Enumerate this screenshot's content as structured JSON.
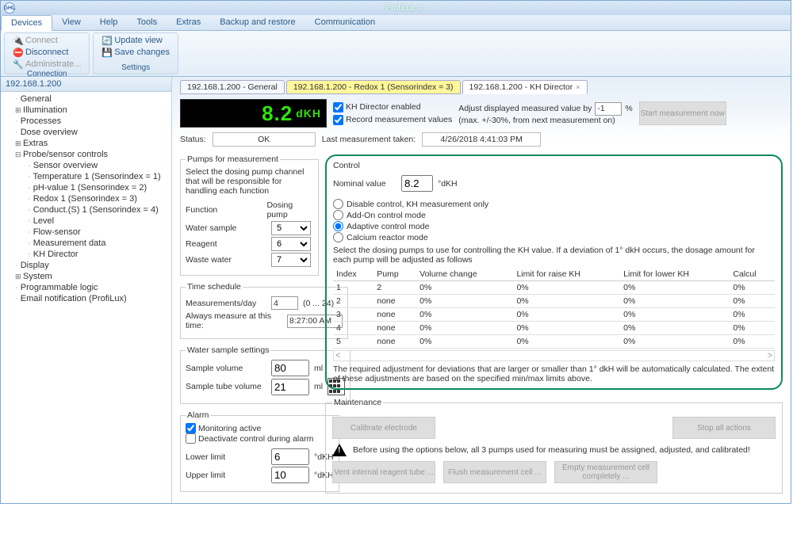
{
  "title": "ProfiLux 4",
  "menu": [
    "Devices",
    "View",
    "Help",
    "Tools",
    "Extras",
    "Backup and restore",
    "Communication"
  ],
  "ribbon": {
    "connection": {
      "title": "Connection",
      "connect": "Connect",
      "disconnect": "Disconnect",
      "administrate": "Administrate..."
    },
    "settings": {
      "title": "Settings",
      "update": "Update view",
      "save": "Save changes"
    }
  },
  "tree": {
    "header": "192.168.1.200",
    "items": [
      {
        "label": "General",
        "t": "leaf",
        "lvl": 1
      },
      {
        "label": "Illumination",
        "t": "expandable",
        "lvl": 1
      },
      {
        "label": "Processes",
        "t": "leaf",
        "lvl": 1
      },
      {
        "label": "Dose overview",
        "t": "leaf",
        "lvl": 1
      },
      {
        "label": "Extras",
        "t": "expandable",
        "lvl": 1
      },
      {
        "label": "Probe/sensor controls",
        "t": "expanded",
        "lvl": 1
      },
      {
        "label": "Sensor overview",
        "t": "leaf",
        "lvl": 2
      },
      {
        "label": "Temperature 1 (Sensorindex = 1)",
        "t": "leaf",
        "lvl": 2
      },
      {
        "label": "pH-value 1 (Sensorindex = 2)",
        "t": "leaf",
        "lvl": 2
      },
      {
        "label": "Redox 1 (Sensorindex = 3)",
        "t": "leaf",
        "lvl": 2
      },
      {
        "label": "Conduct.(S) 1 (Sensorindex = 4)",
        "t": "leaf",
        "lvl": 2
      },
      {
        "label": "Level",
        "t": "leaf",
        "lvl": 2
      },
      {
        "label": "Flow-sensor",
        "t": "leaf",
        "lvl": 2
      },
      {
        "label": "Measurement data",
        "t": "leaf",
        "lvl": 2
      },
      {
        "label": "KH Director",
        "t": "leaf",
        "lvl": 2
      },
      {
        "label": "Display",
        "t": "leaf",
        "lvl": 1
      },
      {
        "label": "System",
        "t": "expandable",
        "lvl": 1
      },
      {
        "label": "Programmable logic",
        "t": "leaf",
        "lvl": 1
      },
      {
        "label": "Email notification (ProfiLux)",
        "t": "leaf",
        "lvl": 1
      }
    ]
  },
  "tabs": [
    {
      "label": "192.168.1.200 - General",
      "style": "",
      "close": false
    },
    {
      "label": "192.168.1.200 - Redox 1 (Sensorindex = 3)",
      "style": "yellow",
      "close": false
    },
    {
      "label": "192.168.1.200 - KH Director",
      "style": "active",
      "close": true
    }
  ],
  "lcd": {
    "value": "8.2",
    "unit": "dKH"
  },
  "checks": {
    "enabled": "KH Director enabled",
    "record": "Record measurement values"
  },
  "adjust": {
    "label": "Adjust displayed measured value by",
    "value": "-1",
    "unit": "%",
    "hint": "(max. +/-30%, from next measurement on)"
  },
  "start_btn": "Start measurement now",
  "status": {
    "label": "Status:",
    "value": "OK",
    "last_lbl": "Last measurement taken:",
    "last_val": "4/26/2018 4:41:03 PM"
  },
  "pumps": {
    "title": "Pumps for measurement",
    "desc": "Select the dosing pump channel that will be responsible for handling each function",
    "h1": "Function",
    "h2": "Dosing pump",
    "rows": [
      {
        "f": "Water sample",
        "p": "5"
      },
      {
        "f": "Reagent",
        "p": "6"
      },
      {
        "f": "Waste water",
        "p": "7"
      }
    ]
  },
  "schedule": {
    "title": "Time schedule",
    "meas_lbl": "Measurements/day",
    "meas_val": "4",
    "range": "(0 ... 24)",
    "always_lbl": "Always measure at this time:",
    "always_val": "8:27:00 AM"
  },
  "sample": {
    "title": "Water sample settings",
    "vol_lbl": "Sample volume",
    "vol_val": "80",
    "tube_lbl": "Sample tube volume",
    "tube_val": "21",
    "unit": "ml"
  },
  "alarm": {
    "title": "Alarm",
    "mon": "Monitoring active",
    "deact": "Deactivate control during alarm",
    "lower_lbl": "Lower limit",
    "lower_val": "6",
    "upper_lbl": "Upper limit",
    "upper_val": "10",
    "unit": "°dKH"
  },
  "control": {
    "title": "Control",
    "nominal_lbl": "Nominal value",
    "nominal_val": "8.2",
    "nominal_unit": "°dKH",
    "r1": "Disable control, KH measurement only",
    "r2": "Add-On control mode",
    "r3": "Adaptive control mode",
    "r4": "Calcium reactor mode",
    "desc": "Select the dosing pumps to use for controlling the KH value. If a deviation of 1° dkH occurs, the dosage amount for each pump will be adjusted as follows",
    "cols": [
      "Index",
      "Pump",
      "Volume change",
      "Limit for raise KH",
      "Limit for lower KH",
      "Calcul"
    ],
    "rows": [
      {
        "i": "1",
        "p": "2",
        "v": "0%",
        "r": "0%",
        "l": "0%",
        "c": "0%"
      },
      {
        "i": "2",
        "p": "none",
        "v": "0%",
        "r": "0%",
        "l": "0%",
        "c": "0%"
      },
      {
        "i": "3",
        "p": "none",
        "v": "0%",
        "r": "0%",
        "l": "0%",
        "c": "0%"
      },
      {
        "i": "4",
        "p": "none",
        "v": "0%",
        "r": "0%",
        "l": "0%",
        "c": "0%"
      },
      {
        "i": "5",
        "p": "none",
        "v": "0%",
        "r": "0%",
        "l": "0%",
        "c": "0%"
      }
    ],
    "foot": "The required adjustment for deviations that are larger or smaller than 1° dkH will be automatically calculated. The extent of these adjustments are based on the specified min/max limits above."
  },
  "maint": {
    "title": "Maintenance",
    "b1": "Calibrate electrode",
    "b2": "Stop all actions",
    "warn": "Before using the options below, all 3 pumps used for measuring must be assigned, adjusted, and calibrated!",
    "b3": "Vent internal reagent tube ...",
    "b4": "Flush measurement cell ...",
    "b5": "Empty measurement cell completely ..."
  }
}
